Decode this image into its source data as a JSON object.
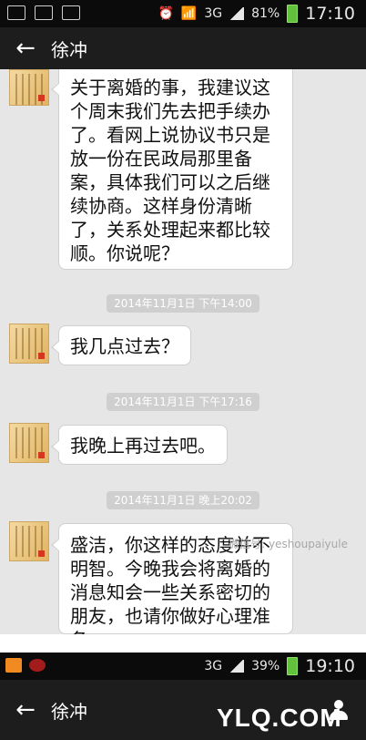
{
  "statusbar_top": {
    "network": "3G",
    "battery": "81%",
    "time": "17:10",
    "icons": [
      "gmail-icon",
      "mail-icon",
      "image-icon",
      "alarm-icon",
      "wifi-icon",
      "signal-icon",
      "battery-icon"
    ]
  },
  "header": {
    "back_icon": "←",
    "title": "徐冲"
  },
  "messages": [
    {
      "text": "关于离婚的事，我建议这个周末我们先去把手续办了。看网上说协议书只是放一份在民政局那里备案，具体我们可以之后继续协商。这样身份清晰了，关系处理起来都比较顺。你说呢？"
    },
    {
      "timestamp": "2014年11月1日 下午14:00"
    },
    {
      "text": "我几点过去？"
    },
    {
      "timestamp": "2014年11月1日 下午17:16"
    },
    {
      "text": "我晚上再过去吧。"
    },
    {
      "timestamp": "2014年11月1日 晚上20:02"
    },
    {
      "text": "盛洁，你这样的态度并不明智。今晚我会将离婚的消息知会一些关系密切的朋友，也请你做好心理准备。"
    }
  ],
  "watermark": "微信号: yeshoupaiyule",
  "statusbar_bottom": {
    "network": "3G",
    "battery": "39%",
    "time": "19:10",
    "icons": [
      "app-orange-icon",
      "app-red-icon",
      "signal-icon",
      "battery-icon"
    ]
  },
  "header2": {
    "back_icon": "←",
    "title": "徐冲",
    "person_icon": "person-icon"
  },
  "site_logo": "YLQ.COM"
}
